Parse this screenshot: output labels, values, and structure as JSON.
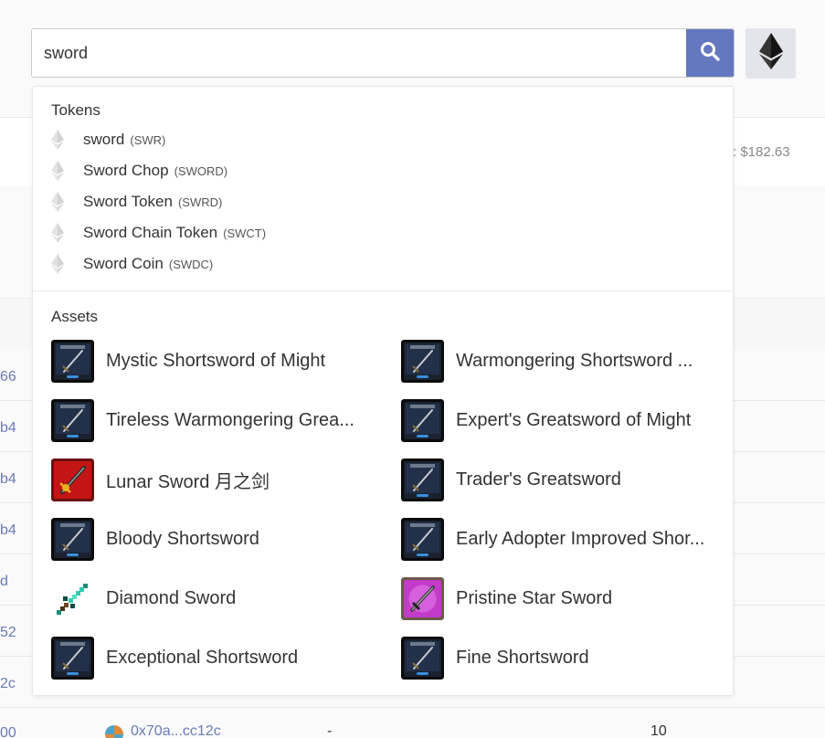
{
  "search": {
    "value": "sword"
  },
  "background": {
    "price_text": ": $182.63",
    "left_fragments": [
      "66",
      "b4",
      "b4",
      "b4",
      "d",
      "52",
      "2c",
      "00"
    ],
    "bottom_address": "0x70a...cc12c",
    "bottom_dash": "-",
    "bottom_number": "10"
  },
  "dropdown": {
    "tokens_title": "Tokens",
    "tokens": [
      {
        "name": "sword",
        "symbol": "(SWR)"
      },
      {
        "name": "Sword Chop",
        "symbol": "(SWORD)"
      },
      {
        "name": "Sword Token",
        "symbol": "(SWRD)"
      },
      {
        "name": "Sword Chain Token",
        "symbol": "(SWCT)"
      },
      {
        "name": "Sword Coin",
        "symbol": "(SWDC)"
      }
    ],
    "assets_title": "Assets",
    "assets": [
      {
        "name": "Mystic Shortsword of Might",
        "thumb": "dark-card"
      },
      {
        "name": "Warmongering Shortsword ...",
        "thumb": "dark-card"
      },
      {
        "name": "Tireless Warmongering Grea...",
        "thumb": "dark-card"
      },
      {
        "name": "Expert's Greatsword of Might",
        "thumb": "dark-card"
      },
      {
        "name": "Lunar Sword 月之剑",
        "thumb": "red-card"
      },
      {
        "name": "Trader's Greatsword",
        "thumb": "dark-card"
      },
      {
        "name": "Bloody Shortsword",
        "thumb": "dark-card"
      },
      {
        "name": "Early Adopter Improved Shor...",
        "thumb": "dark-card"
      },
      {
        "name": "Diamond Sword",
        "thumb": "pixel-sword"
      },
      {
        "name": "Pristine Star Sword",
        "thumb": "purple-card"
      },
      {
        "name": "Exceptional Shortsword",
        "thumb": "dark-card"
      },
      {
        "name": "Fine Shortsword",
        "thumb": "dark-card"
      }
    ]
  },
  "colors": {
    "accent": "#6478c0",
    "link": "#6a7bb5"
  }
}
